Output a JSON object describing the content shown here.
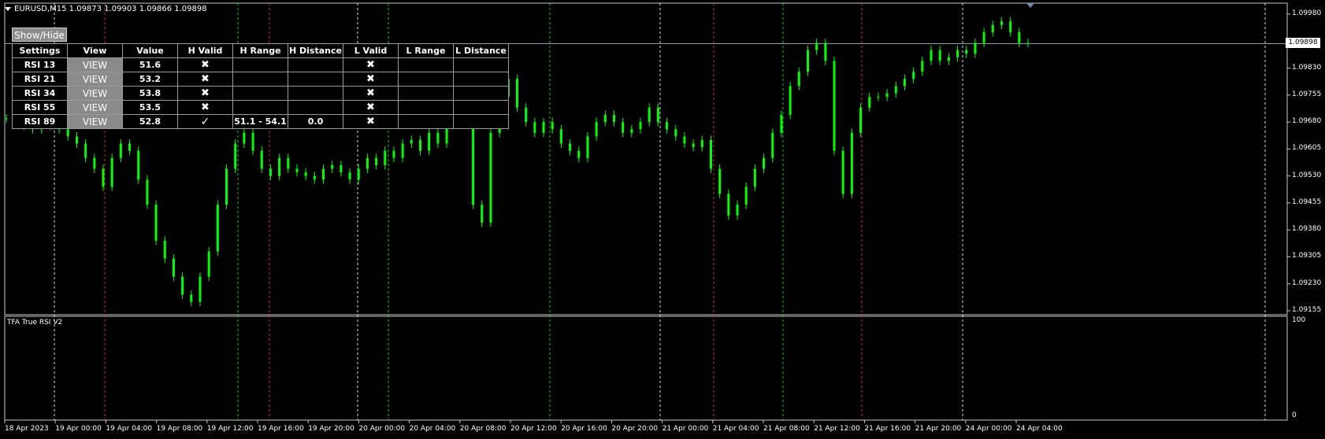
{
  "chart": {
    "symbol_info": "EURUSD,M15  1.09873 1.09903 1.09866 1.09898",
    "current_price_label": "1.09898",
    "price_ticks": [
      "1.09980",
      "1.09830",
      "1.09755",
      "1.09680",
      "1.09605",
      "1.09530",
      "1.09455",
      "1.09380",
      "1.09305",
      "1.09230",
      "1.09155"
    ],
    "time_ticks": [
      "18 Apr 2023",
      "19 Apr 00:00",
      "19 Apr 04:00",
      "19 Apr 08:00",
      "19 Apr 12:00",
      "19 Apr 16:00",
      "19 Apr 20:00",
      "20 Apr 00:00",
      "20 Apr 04:00",
      "20 Apr 08:00",
      "20 Apr 12:00",
      "20 Apr 16:00",
      "20 Apr 20:00",
      "21 Apr 00:00",
      "21 Apr 04:00",
      "21 Apr 08:00",
      "21 Apr 12:00",
      "21 Apr 16:00",
      "21 Apr 20:00",
      "24 Apr 00:00",
      "24 Apr 04:00"
    ],
    "candle_color": "#00ff00",
    "background": "#000000"
  },
  "chart_data": {
    "type": "line",
    "title": "EURUSD,M15",
    "ylim": [
      1.09155,
      1.0998
    ],
    "series": [
      {
        "name": "EURUSD",
        "values": [
          1.0969,
          1.0968,
          1.0967,
          1.0966,
          1.0968,
          1.0967,
          1.0966,
          1.0964,
          1.0962,
          1.0958,
          1.0955,
          1.095,
          1.0958,
          1.0962,
          1.096,
          1.0952,
          1.0945,
          1.0935,
          1.093,
          1.0925,
          1.092,
          1.0918,
          1.0925,
          1.0932,
          1.0945,
          1.0955,
          1.0962,
          1.0965,
          1.096,
          1.0955,
          1.0953,
          1.0958,
          1.0955,
          1.0954,
          1.0953,
          1.0952,
          1.0955,
          1.0956,
          1.0954,
          1.0952,
          1.0955,
          1.0958,
          1.0956,
          1.096,
          1.0958,
          1.0962,
          1.0963,
          1.096,
          1.0965,
          1.0962,
          1.0975,
          1.0972,
          1.0968,
          1.0945,
          1.094,
          1.0965,
          1.0975,
          1.098,
          1.0972,
          1.0968,
          1.0965,
          1.0968,
          1.0966,
          1.0962,
          1.096,
          1.0958,
          1.0964,
          1.0968,
          1.097,
          1.0968,
          1.0965,
          1.0966,
          1.0968,
          1.0972,
          1.0968,
          1.0966,
          1.0964,
          1.0962,
          1.0961,
          1.0963,
          1.0955,
          1.0948,
          1.0942,
          1.0945,
          1.095,
          1.0955,
          1.0958,
          1.0965,
          1.097,
          1.0978,
          1.0982,
          1.0988,
          1.099,
          1.0985,
          1.096,
          1.0948,
          1.0965,
          1.0972,
          1.0975,
          1.0975,
          1.0976,
          1.0978,
          1.098,
          1.0982,
          1.0985,
          1.0988,
          1.0985,
          1.0986,
          1.0988,
          1.0987,
          1.099,
          1.0993,
          1.0995,
          1.0996,
          1.0993,
          1.099,
          1.099
        ]
      }
    ],
    "xlabel": "",
    "ylabel": ""
  },
  "panel": {
    "show_hide_label": "Show/Hide",
    "headers": [
      "Settings",
      "View",
      "Value",
      "H Valid",
      "H Range",
      "H Distance",
      "L Valid",
      "L Range",
      "L Distance"
    ],
    "rows": [
      {
        "setting": "RSI 13",
        "view": "VIEW",
        "value": "51.6",
        "h_valid": "✖",
        "h_range": "",
        "h_distance": "",
        "l_valid": "✖",
        "l_range": "",
        "l_distance": ""
      },
      {
        "setting": "RSI 21",
        "view": "VIEW",
        "value": "53.2",
        "h_valid": "✖",
        "h_range": "",
        "h_distance": "",
        "l_valid": "✖",
        "l_range": "",
        "l_distance": ""
      },
      {
        "setting": "RSI 34",
        "view": "VIEW",
        "value": "53.8",
        "h_valid": "✖",
        "h_range": "",
        "h_distance": "",
        "l_valid": "✖",
        "l_range": "",
        "l_distance": ""
      },
      {
        "setting": "RSI 55",
        "view": "VIEW",
        "value": "53.5",
        "h_valid": "✖",
        "h_range": "",
        "h_distance": "",
        "l_valid": "✖",
        "l_range": "",
        "l_distance": ""
      },
      {
        "setting": "RSI 89",
        "view": "VIEW",
        "value": "52.8",
        "h_valid": "✓",
        "h_range": "51.1 - 54.1",
        "h_distance": "0.0",
        "l_valid": "✖",
        "l_range": "",
        "l_distance": ""
      }
    ]
  },
  "subwindow": {
    "title": "TFA True RSI V2",
    "max_label": "100",
    "min_label": "0"
  }
}
